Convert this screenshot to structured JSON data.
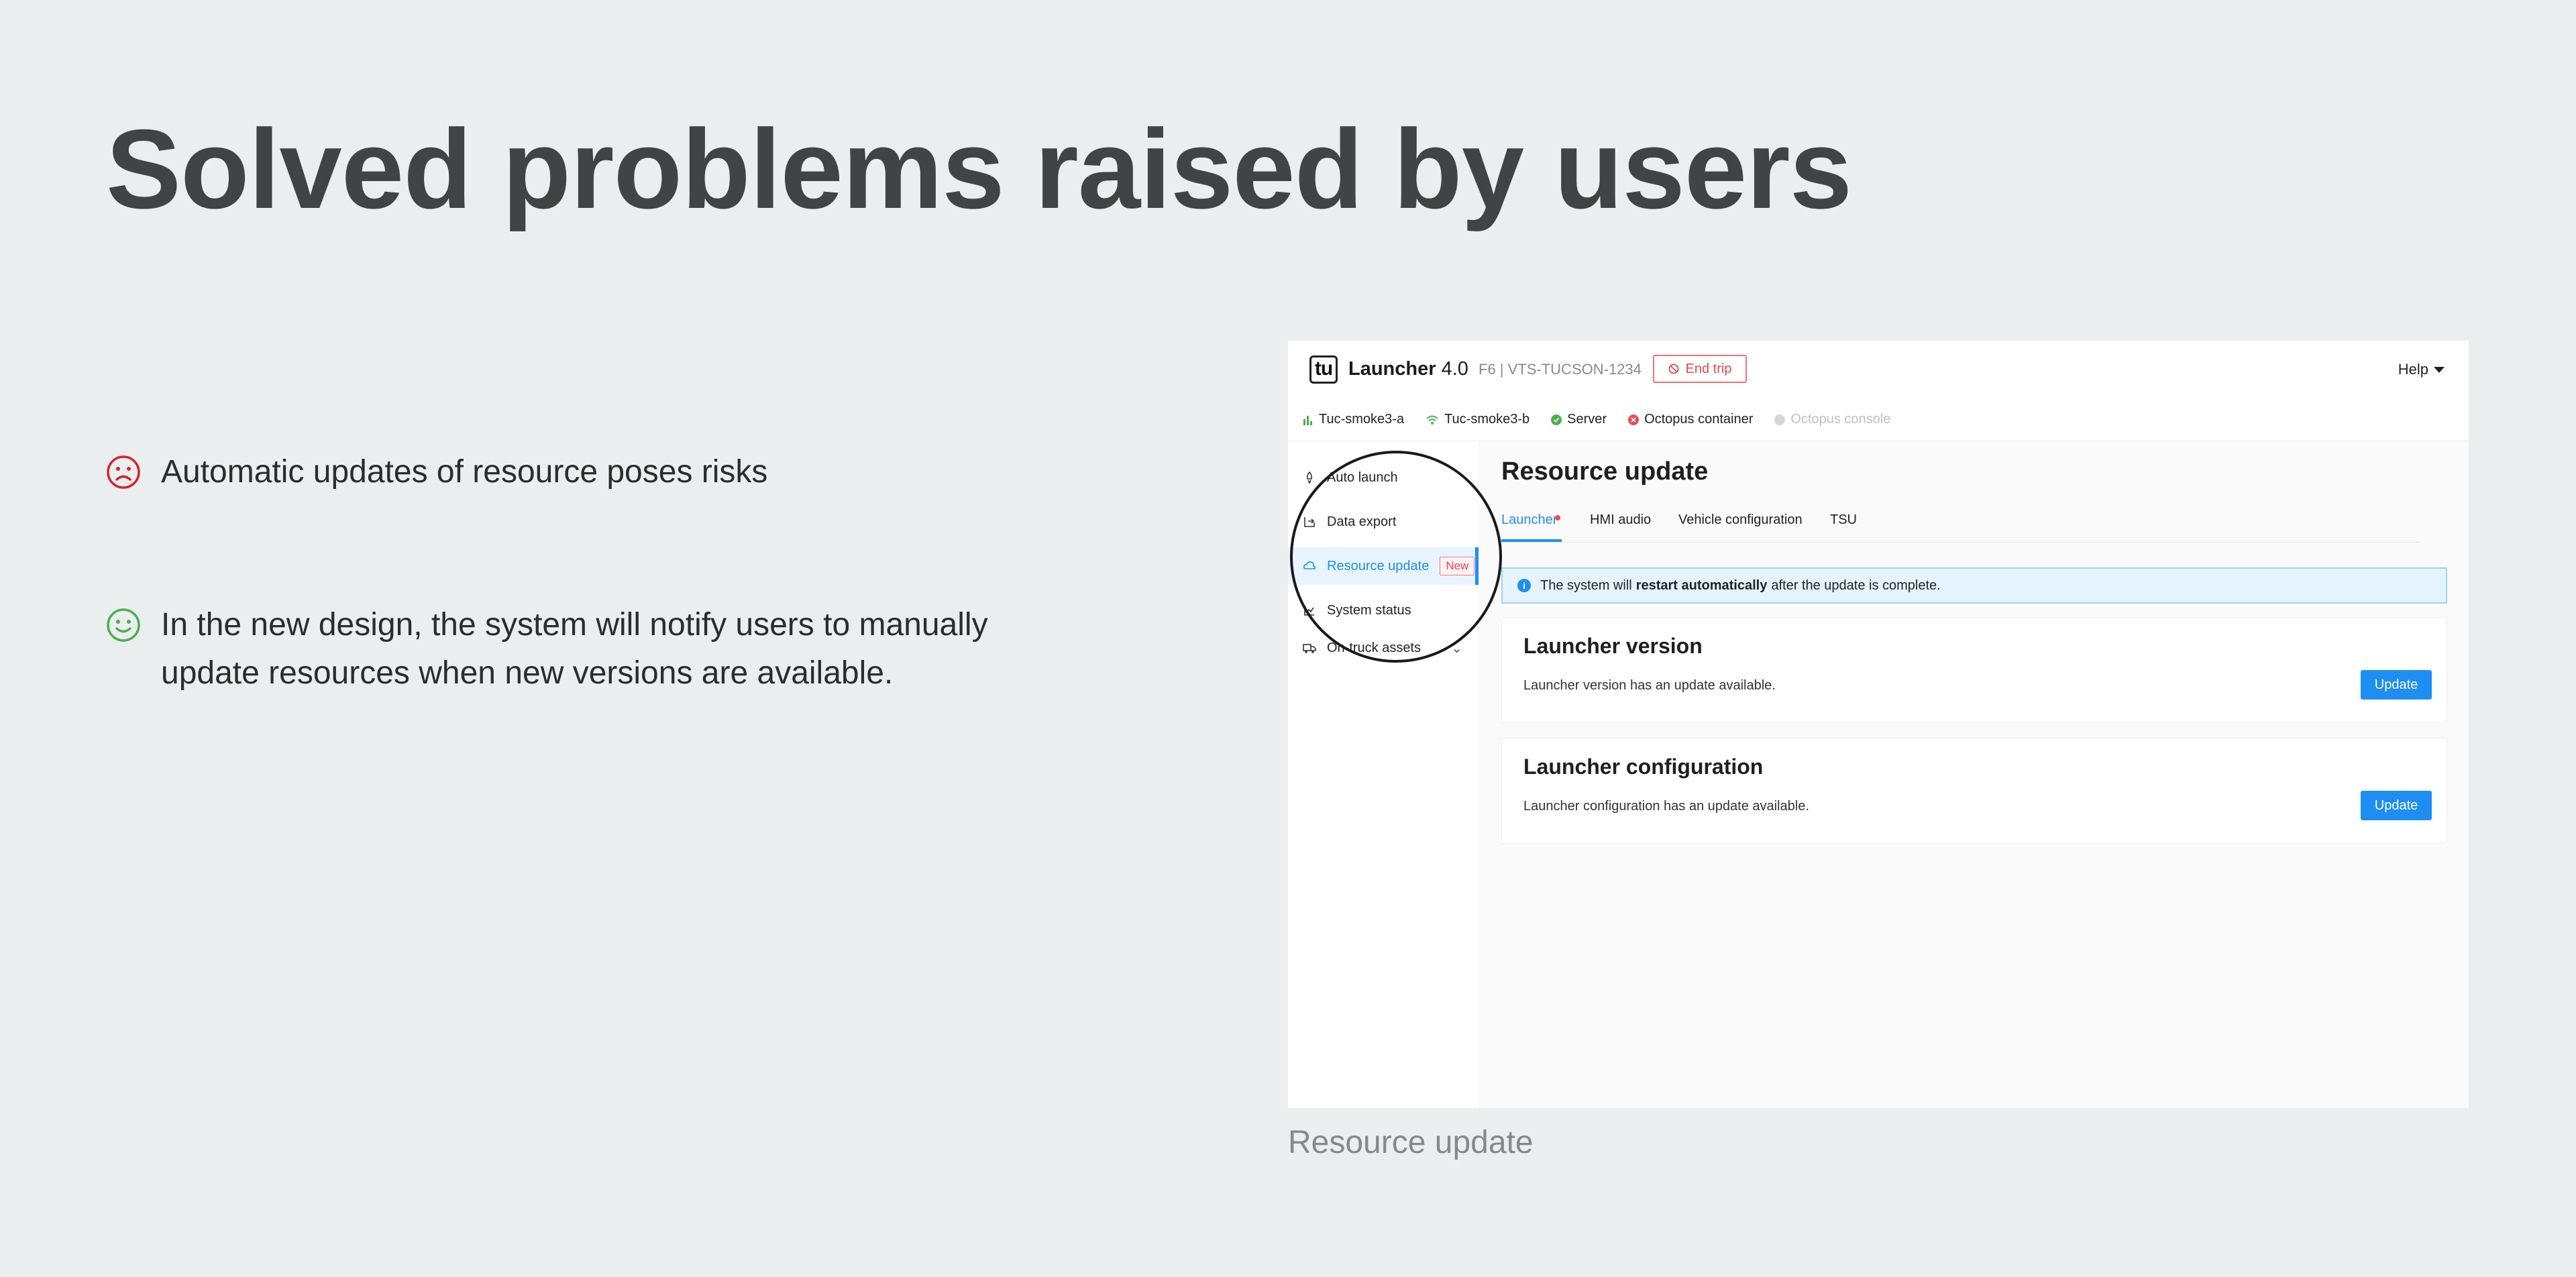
{
  "slide": {
    "title": "Solved problems raised by users",
    "points": [
      {
        "icon": "sad-face-icon",
        "color": "#d2262c",
        "text": "Automatic updates of resource poses risks"
      },
      {
        "icon": "smile-face-icon",
        "color": "#4caf50",
        "text": "In the new design, the system will notify users to manually update resources when new versions are available."
      }
    ],
    "caption": "Resource update"
  },
  "app": {
    "logo": "tu",
    "name": "Launcher",
    "version": "4.0",
    "vehicle": "F6 | VTS-TUCSON-1234",
    "end_trip": "End trip",
    "help": "Help",
    "status": [
      {
        "label": "Tuc-smoke3-a",
        "icon": "signal-bars-icon",
        "color": "#4caf50"
      },
      {
        "label": "Tuc-smoke3-b",
        "icon": "wifi-icon",
        "color": "#4caf50"
      },
      {
        "label": "Server",
        "icon": "check-circle-icon",
        "color": "#4caf50"
      },
      {
        "label": "Octopus container",
        "icon": "error-circle-icon",
        "color": "#f24a52"
      },
      {
        "label": "Octopus console",
        "icon": "disabled-dot-icon",
        "color": "#d6d6d6"
      }
    ],
    "nav": [
      {
        "label": "Auto launch",
        "icon": "rocket-icon"
      },
      {
        "label": "Data export",
        "icon": "export-icon"
      },
      {
        "label": "Resource update",
        "icon": "cloud-sync-icon",
        "badge": "New",
        "active": true
      },
      {
        "label": "System status",
        "icon": "line-chart-icon"
      },
      {
        "label": "On-truck assets",
        "icon": "truck-icon",
        "expand": "chevron-down-icon"
      }
    ],
    "page": {
      "title": "Resource update",
      "tabs": [
        "Launcher",
        "HMI audio",
        "Vehicle configuration",
        "TSU"
      ],
      "active_tab": "Launcher",
      "info": {
        "before": "The system will",
        "bold": "restart automatically",
        "after": "after the update is complete."
      },
      "cards": [
        {
          "title": "Launcher version",
          "desc": "Launcher version has an update available.",
          "button": "Update"
        },
        {
          "title": "Launcher configuration",
          "desc": "Launcher configuration has an update available.",
          "button": "Update"
        }
      ]
    },
    "accent": "#1e8ef2"
  }
}
